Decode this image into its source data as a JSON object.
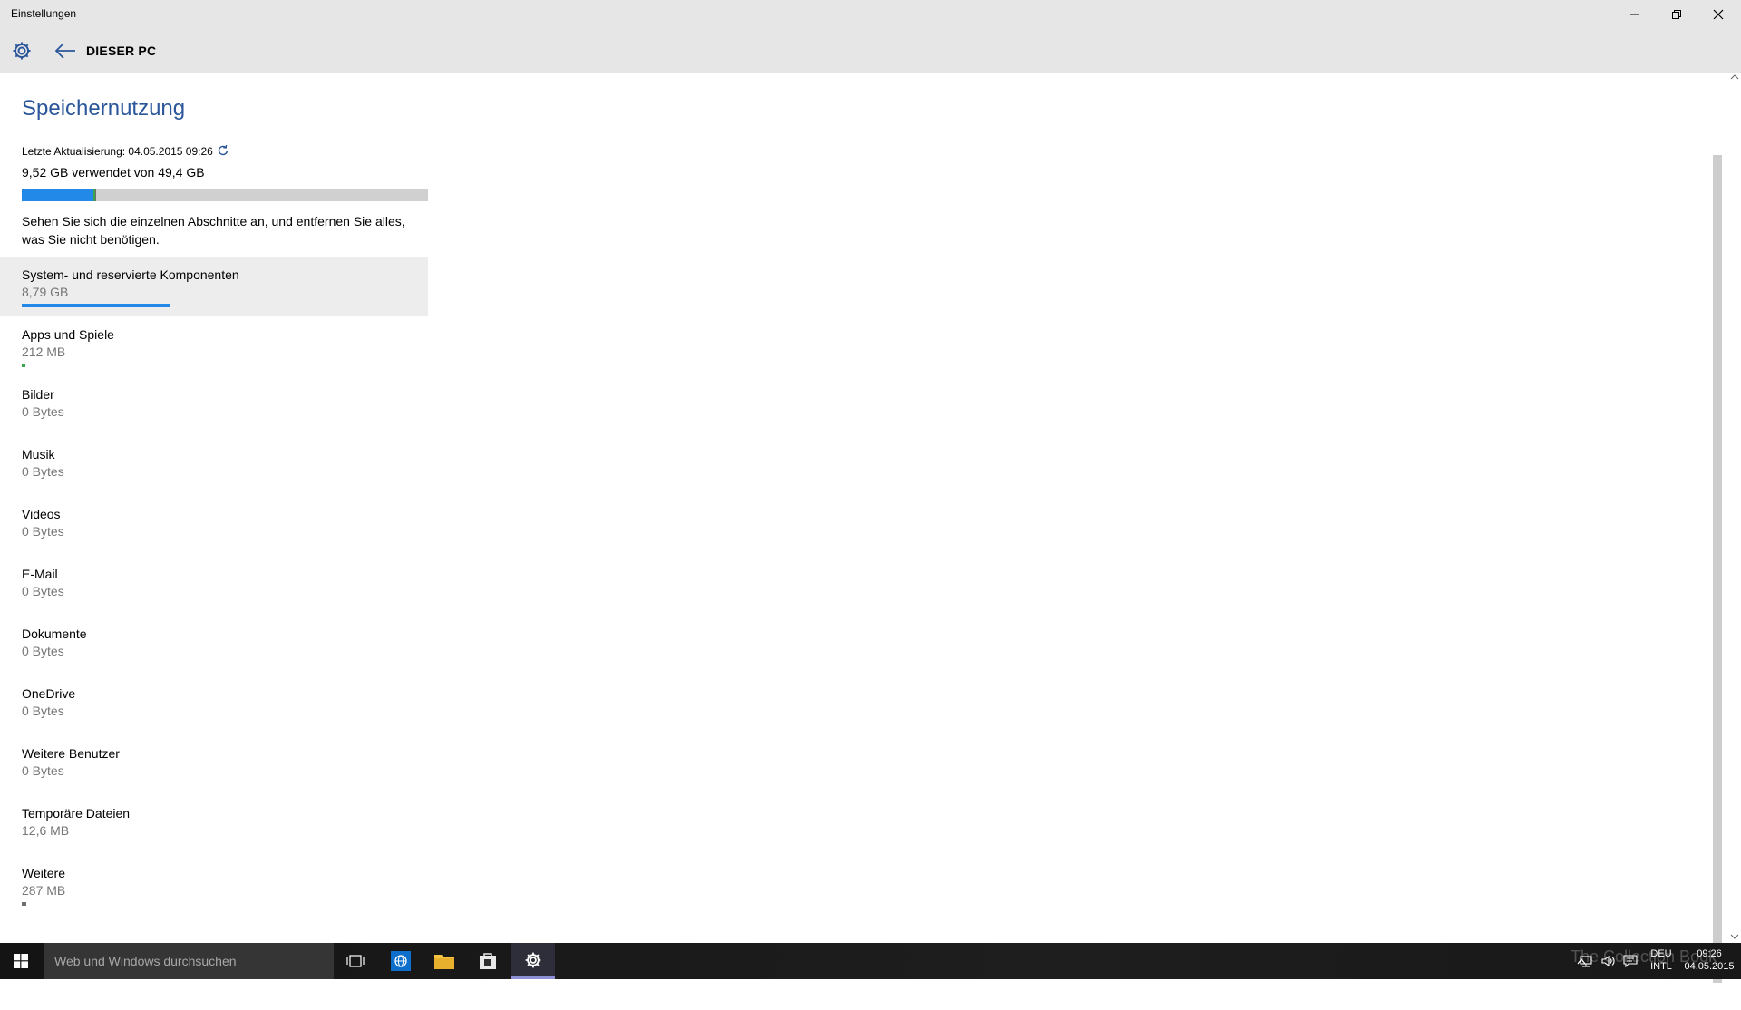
{
  "window": {
    "title": "Einstellungen",
    "heading": "DIESER PC"
  },
  "main": {
    "title": "Speichernutzung",
    "last_updated": "Letzte Aktualisierung: 04.05.2015 09:26",
    "usage": "9,52 GB verwendet von 49,4 GB",
    "usage_fraction": 0.193,
    "description": "Sehen Sie sich die einzelnen Abschnitte an, und entfernen Sie alles, was Sie nicht benötigen.",
    "categories": [
      {
        "name": "System- und reservierte Komponenten",
        "size": "8,79 GB",
        "fraction": 0.178,
        "color": "#2289e8",
        "selected": true
      },
      {
        "name": "Apps und Spiele",
        "size": "212 MB",
        "fraction": 0.0043,
        "color": "#3aa54c"
      },
      {
        "name": "Bilder",
        "size": "0 Bytes",
        "fraction": 0
      },
      {
        "name": "Musik",
        "size": "0 Bytes",
        "fraction": 0
      },
      {
        "name": "Videos",
        "size": "0 Bytes",
        "fraction": 0
      },
      {
        "name": "E-Mail",
        "size": "0 Bytes",
        "fraction": 0
      },
      {
        "name": "Dokumente",
        "size": "0 Bytes",
        "fraction": 0
      },
      {
        "name": "OneDrive",
        "size": "0 Bytes",
        "fraction": 0
      },
      {
        "name": "Weitere Benutzer",
        "size": "0 Bytes",
        "fraction": 0
      },
      {
        "name": "Temporäre Dateien",
        "size": "12,6 MB",
        "fraction": 0.0003
      },
      {
        "name": "Weitere",
        "size": "287 MB",
        "fraction": 0.0058,
        "color": "#6e6e6e"
      }
    ]
  },
  "taskbar": {
    "search_placeholder": "Web und Windows durchsuchen",
    "language": "DEU",
    "keyboard": "INTL",
    "time": "09:26",
    "date": "04.05.2015",
    "watermark": "The Collection Book"
  },
  "colors": {
    "accent": "#2b579a",
    "bar_system": "#2289e8",
    "bar_apps": "#3aa54c",
    "bar_other": "#6e6e6e",
    "settings_active": "#8f8fd8"
  }
}
